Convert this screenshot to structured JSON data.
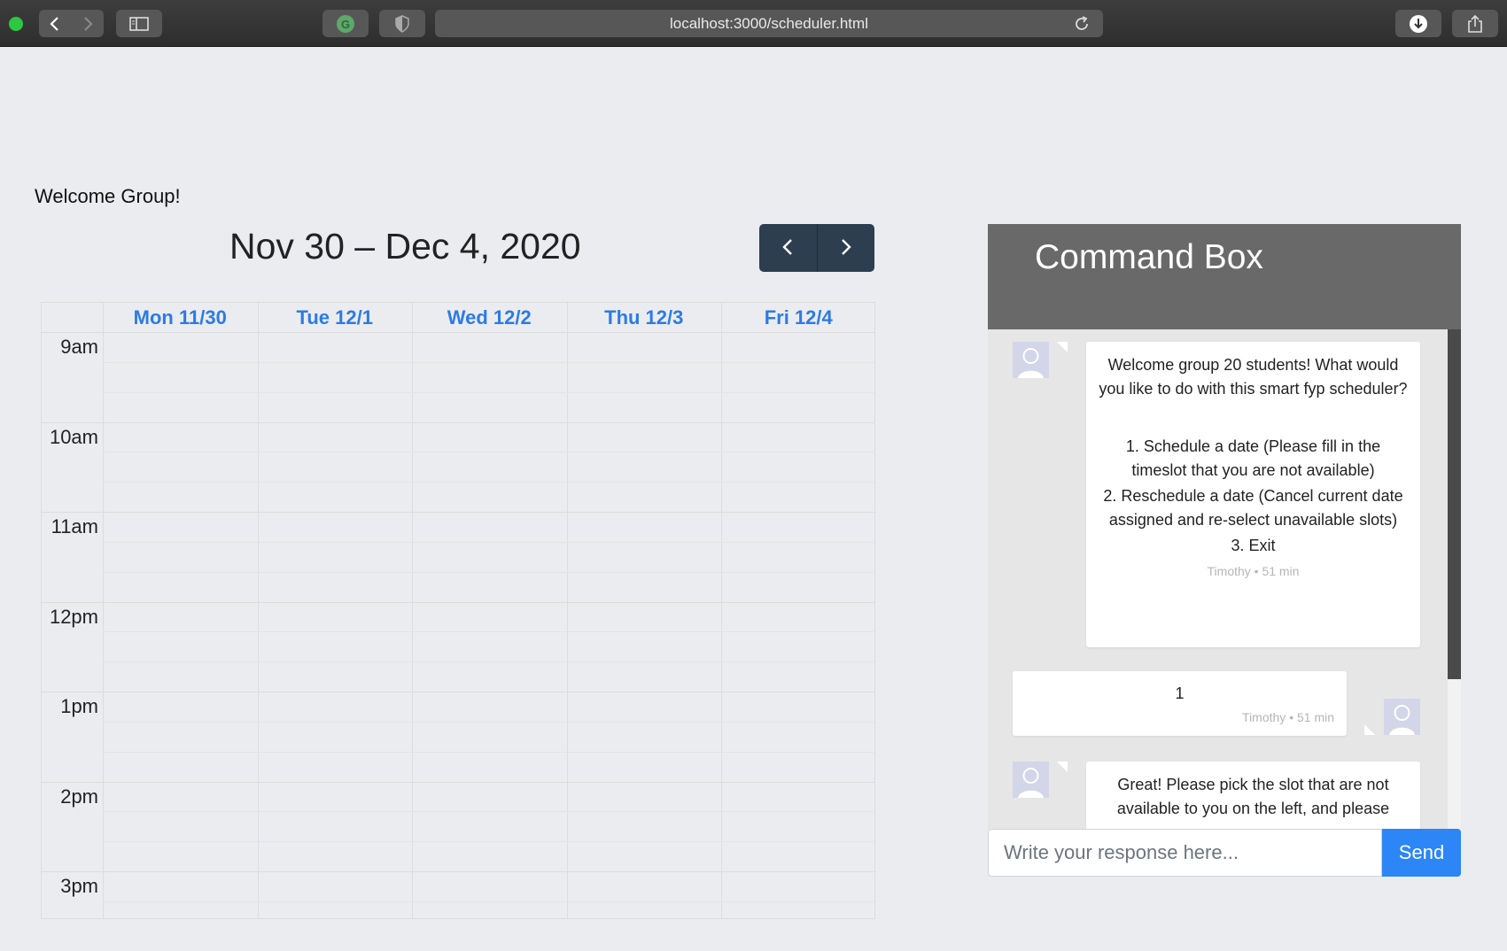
{
  "browser": {
    "url": "localhost:3000/scheduler.html"
  },
  "page": {
    "welcome": "Welcome Group!"
  },
  "calendar": {
    "title": "Nov 30 – Dec 4, 2020",
    "days": [
      "Mon 11/30",
      "Tue 12/1",
      "Wed 12/2",
      "Thu 12/3",
      "Fri 12/4"
    ],
    "times": [
      "9am",
      "10am",
      "11am",
      "12pm",
      "1pm",
      "2pm",
      "3pm"
    ],
    "header_color": "#2c7be5",
    "nav_color": "#2c3e50"
  },
  "command_box": {
    "title": "Command Box",
    "messages": [
      {
        "side": "left",
        "lines": [
          "Welcome group 20 students! What would you like to do with this smart fyp scheduler?",
          "",
          "1. Schedule a date (Please fill in the timeslot that you are not available)",
          "2. Reschedule a date (Cancel current date assigned and re-select unavailable slots)",
          "3. Exit"
        ],
        "meta": "Timothy • 51 min"
      },
      {
        "side": "right",
        "lines": [
          "1"
        ],
        "meta": "Timothy • 51 min"
      },
      {
        "side": "left",
        "lines": [
          "Great! Please pick the slot that are not available to you on the left, and please"
        ]
      }
    ],
    "input_placeholder": "Write your response here...",
    "send_label": "Send",
    "send_color": "#2c86f5",
    "header_color": "#696969"
  }
}
